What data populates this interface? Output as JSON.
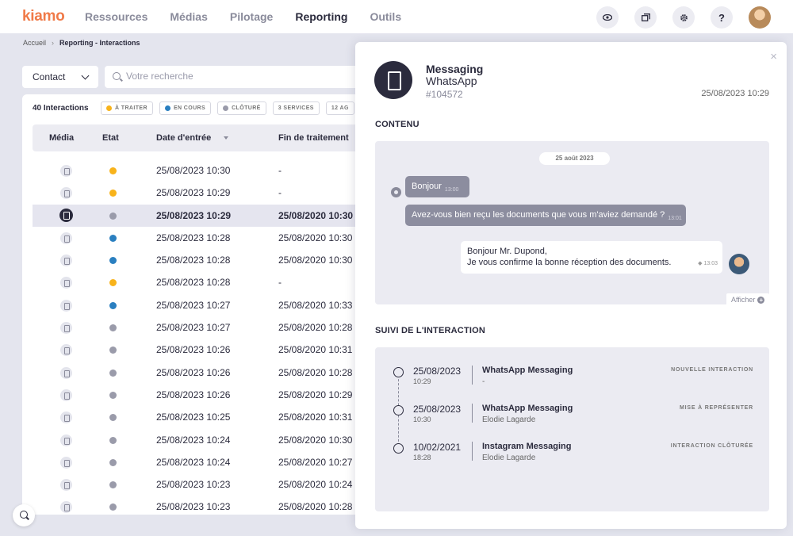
{
  "app": {
    "logo": "kiamo"
  },
  "nav": {
    "items": [
      "Ressources",
      "Médias",
      "Pilotage",
      "Reporting",
      "Outils"
    ],
    "active": "Reporting"
  },
  "topbar": {
    "icons": [
      "eye-icon",
      "windows-icon",
      "gear-icon",
      "help-icon"
    ],
    "help_label": "?"
  },
  "breadcrumb": {
    "home": "Accueil",
    "separator": "›",
    "current": "Reporting - Interactions"
  },
  "filters": {
    "contact_select": "Contact",
    "search_placeholder": "Votre recherche"
  },
  "table": {
    "count_label": "40 Interactions",
    "chips": [
      {
        "label": "À TRAITER",
        "color": "#f8b31b"
      },
      {
        "label": "EN COURS",
        "color": "#2a7fc0"
      },
      {
        "label": "CLÔTURÉ",
        "color": "#9a9baa"
      },
      {
        "label": "3 SERVICES",
        "color": ""
      },
      {
        "label": "12 AG",
        "color": ""
      }
    ],
    "headers": {
      "media": "Média",
      "etat": "Etat",
      "date_entree": "Date d'entrée",
      "fin_traitement": "Fin de traitement"
    },
    "rows": [
      {
        "media": "phone",
        "status": "#f8b31b",
        "entree": "25/08/2023   10:30",
        "fin": "-"
      },
      {
        "media": "headset",
        "status": "#f8b31b",
        "entree": "25/08/2023   10:29",
        "fin": "-"
      },
      {
        "media": "phone",
        "status": "#9a9baa",
        "entree": "25/08/2023   10:29",
        "fin": "25/08/2020   10:30",
        "selected": true
      },
      {
        "media": "phone",
        "status": "#2a7fc0",
        "entree": "25/08/2023   10:28",
        "fin": "25/08/2020   10:30"
      },
      {
        "media": "phone",
        "status": "#2a7fc0",
        "entree": "25/08/2023   10:28",
        "fin": "25/08/2020   10:30"
      },
      {
        "media": "headset",
        "status": "#f8b31b",
        "entree": "25/08/2023   10:28",
        "fin": "-"
      },
      {
        "media": "phone",
        "status": "#2a7fc0",
        "entree": "25/08/2023   10:27",
        "fin": "25/08/2020   10:33"
      },
      {
        "media": "chat",
        "status": "#9a9baa",
        "entree": "25/08/2023   10:27",
        "fin": "25/08/2020   10:28"
      },
      {
        "media": "mail",
        "status": "#9a9baa",
        "entree": "25/08/2023   10:26",
        "fin": "25/08/2020   10:31"
      },
      {
        "media": "headset",
        "status": "#9a9baa",
        "entree": "25/08/2023   10:26",
        "fin": "25/08/2020   10:28"
      },
      {
        "media": "folder",
        "status": "#9a9baa",
        "entree": "25/08/2023   10:26",
        "fin": "25/08/2020   10:29"
      },
      {
        "media": "folder",
        "status": "#9a9baa",
        "entree": "25/08/2023   10:25",
        "fin": "25/08/2020   10:31"
      },
      {
        "media": "phone",
        "status": "#9a9baa",
        "entree": "25/08/2023   10:24",
        "fin": "25/08/2020   10:30"
      },
      {
        "media": "mail",
        "status": "#9a9baa",
        "entree": "25/08/2023   10:24",
        "fin": "25/08/2020   10:27"
      },
      {
        "media": "mail",
        "status": "#9a9baa",
        "entree": "25/08/2023   10:23",
        "fin": "25/08/2020   10:24"
      },
      {
        "media": "folder",
        "status": "#9a9baa",
        "entree": "25/08/2023   10:23",
        "fin": "25/08/2020   10:28"
      }
    ]
  },
  "panel": {
    "close_label": "×",
    "channel": "Messaging",
    "sub_channel": "WhatsApp",
    "id": "#104572",
    "datetime": "25/08/2023 10:29",
    "content_title": "CONTENU",
    "chat": {
      "date_label": "25 août 2023",
      "incoming": [
        {
          "text": "Bonjour",
          "time": "13:00"
        },
        {
          "text": "Avez-vous bien reçu les documents que vous m'aviez demandé ?",
          "time": "13:01"
        }
      ],
      "outgoing": {
        "line1": "Bonjour Mr. Dupond,",
        "line2": "Je vous confirme la bonne réception des documents.",
        "time": "13:03"
      },
      "show_label": "Afficher",
      "show_plus": "+"
    },
    "tracking_title": "SUIVI DE L'INTERACTION",
    "timeline": [
      {
        "date": "25/08/2023",
        "time": "10:29",
        "title": "WhatsApp Messaging",
        "subtitle": "-",
        "badge": "NOUVELLE INTERACTION"
      },
      {
        "date": "25/08/2023",
        "time": "10:30",
        "title": "WhatsApp Messaging",
        "subtitle": "Elodie Lagarde",
        "badge": "MISE À REPRÉSENTER"
      },
      {
        "date": "10/02/2021",
        "time": "18:28",
        "title": "Instagram Messaging",
        "subtitle": "Elodie Lagarde",
        "badge": "INTERACTION CLÔTURÉE"
      }
    ]
  },
  "colors": {
    "brand": "#f07a48",
    "dark": "#2b2b3d",
    "todo": "#f8b31b",
    "in_progress": "#2a7fc0",
    "closed": "#9a9baa"
  }
}
